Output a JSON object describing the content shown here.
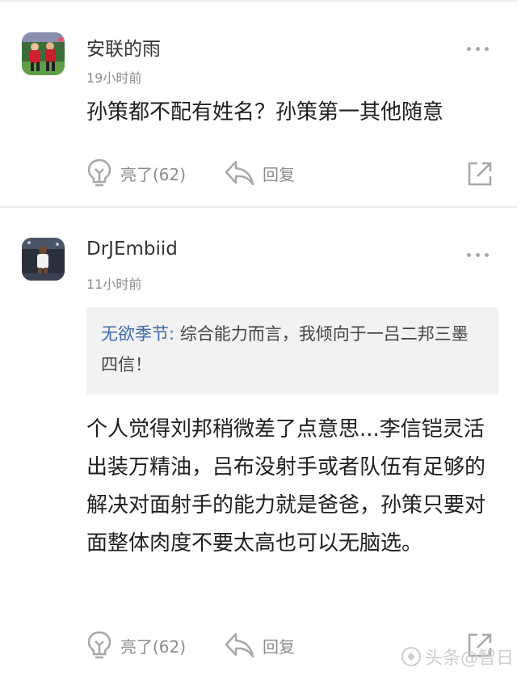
{
  "comments": [
    {
      "username": "安联的雨",
      "time": "19小时前",
      "text": "孙策都不配有姓名？孙策第一其他随意",
      "like_label": "亮了(62)",
      "reply_label": "回复"
    },
    {
      "username": "DrJEmbiid",
      "time": "11小时前",
      "quote_user": "无欲季节:",
      "quote_text": " 综合能力而言，我倾向于一吕二邦三墨四信！",
      "text": "个人觉得刘邦稍微差了点意思...李信铠灵活出装万精油，吕布没射手或者队伍有足够的解决对面射手的能力就是爸爸，孙策只要对面整体肉度不要太高也可以无脑选。",
      "like_label": "亮了(62)",
      "reply_label": "回复"
    }
  ],
  "watermark": "头条@智日"
}
